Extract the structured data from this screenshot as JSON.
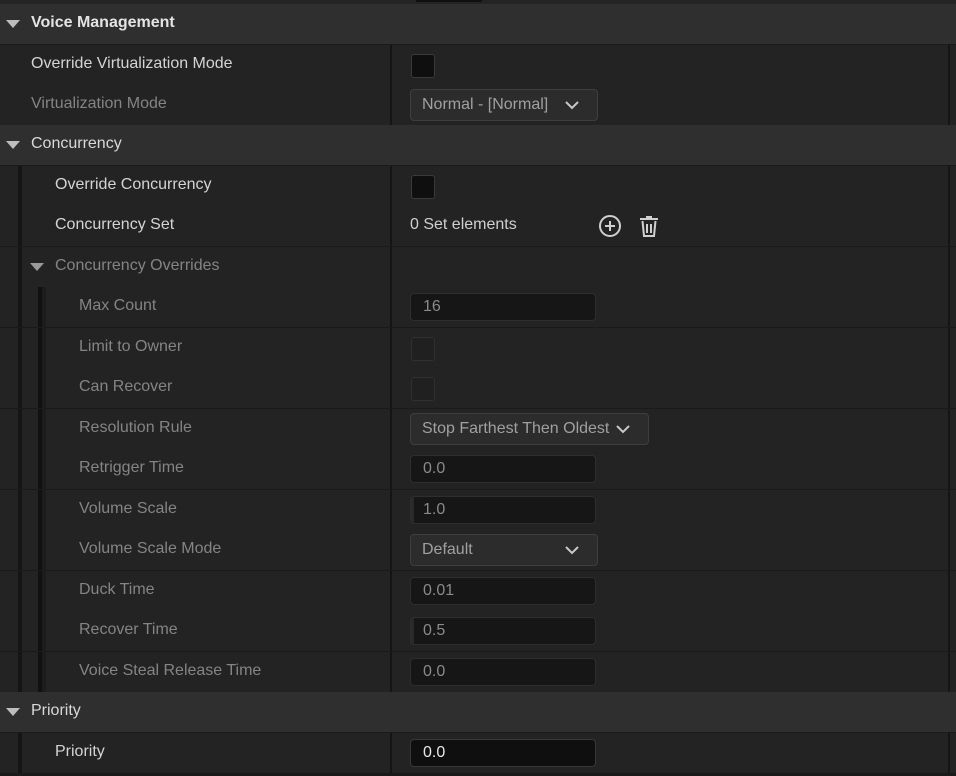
{
  "sections": {
    "voice_management": {
      "title": "Voice Management",
      "override_virtualization_mode": {
        "label": "Override Virtualization Mode",
        "checked": false
      },
      "virtualization_mode": {
        "label": "Virtualization Mode",
        "value": "Normal - [Normal]"
      }
    },
    "concurrency": {
      "title": "Concurrency",
      "override_concurrency": {
        "label": "Override Concurrency",
        "checked": false
      },
      "concurrency_set": {
        "label": "Concurrency Set",
        "value": "0 Set elements",
        "add_icon": "add-element-icon",
        "clear_icon": "trash-icon"
      },
      "overrides": {
        "title": "Concurrency Overrides",
        "max_count": {
          "label": "Max Count",
          "value": "16"
        },
        "limit_to_owner": {
          "label": "Limit to Owner",
          "checked": false
        },
        "can_recover": {
          "label": "Can Recover",
          "checked": false
        },
        "resolution_rule": {
          "label": "Resolution Rule",
          "value": "Stop Farthest Then Oldest"
        },
        "retrigger_time": {
          "label": "Retrigger Time",
          "value": "0.0"
        },
        "volume_scale": {
          "label": "Volume Scale",
          "value": "1.0"
        },
        "volume_scale_mode": {
          "label": "Volume Scale Mode",
          "value": "Default"
        },
        "duck_time": {
          "label": "Duck Time",
          "value": "0.01"
        },
        "recover_time": {
          "label": "Recover Time",
          "value": "0.5"
        },
        "voice_steal_release_time": {
          "label": "Voice Steal Release Time",
          "value": "0.0"
        }
      }
    },
    "priority": {
      "title": "Priority",
      "priority": {
        "label": "Priority",
        "value": "0.0"
      }
    }
  }
}
